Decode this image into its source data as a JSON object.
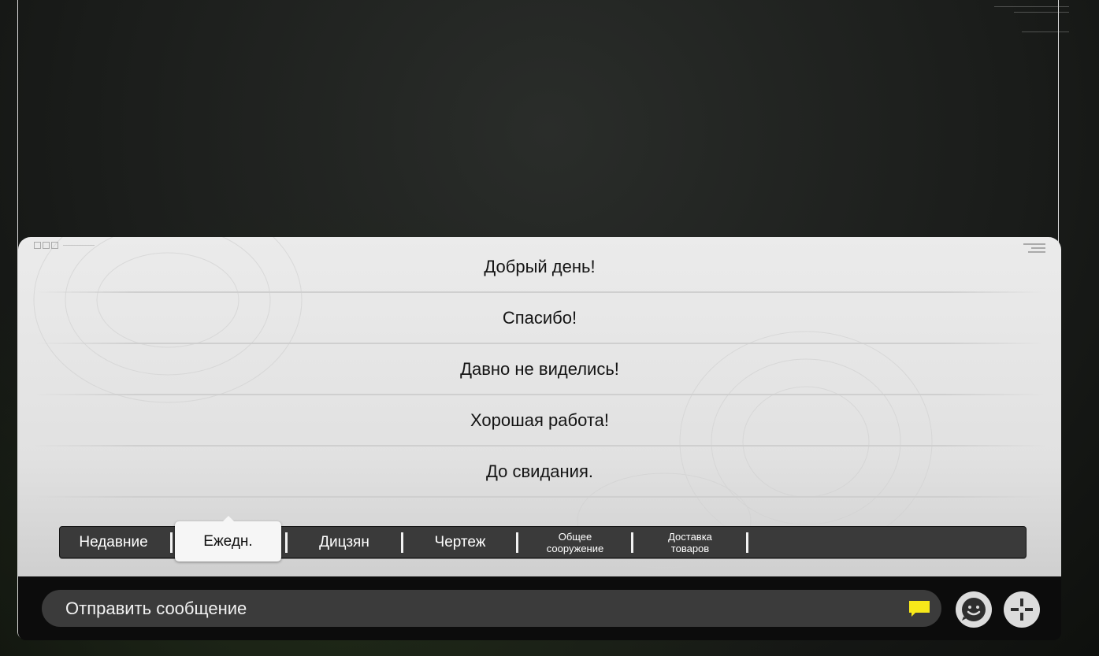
{
  "chat_panel": {
    "quick_phrases": [
      "Добрый день!",
      "Спасибо!",
      "Давно не виделись!",
      "Хорошая работа!",
      "До свидания."
    ]
  },
  "tabs": {
    "recent": "Недавние",
    "daily": "Ежедн.",
    "dicejan": "Дицзян",
    "drawing": "Чертеж",
    "general_1": "Общее",
    "general_2": "сооружение",
    "delivery_1": "Доставка",
    "delivery_2": "товаров",
    "active": "daily"
  },
  "input": {
    "placeholder": "Отправить сообщение"
  },
  "icons": {
    "chat": "chat-bubble-icon",
    "emoji": "emoji-icon",
    "add": "plus-icon"
  },
  "colors": {
    "accent_yellow": "#f7e81a",
    "panel_bg": "#e6e6e6",
    "tab_bar_bg": "#3a3a3a",
    "input_bg": "#3b3b3b"
  }
}
